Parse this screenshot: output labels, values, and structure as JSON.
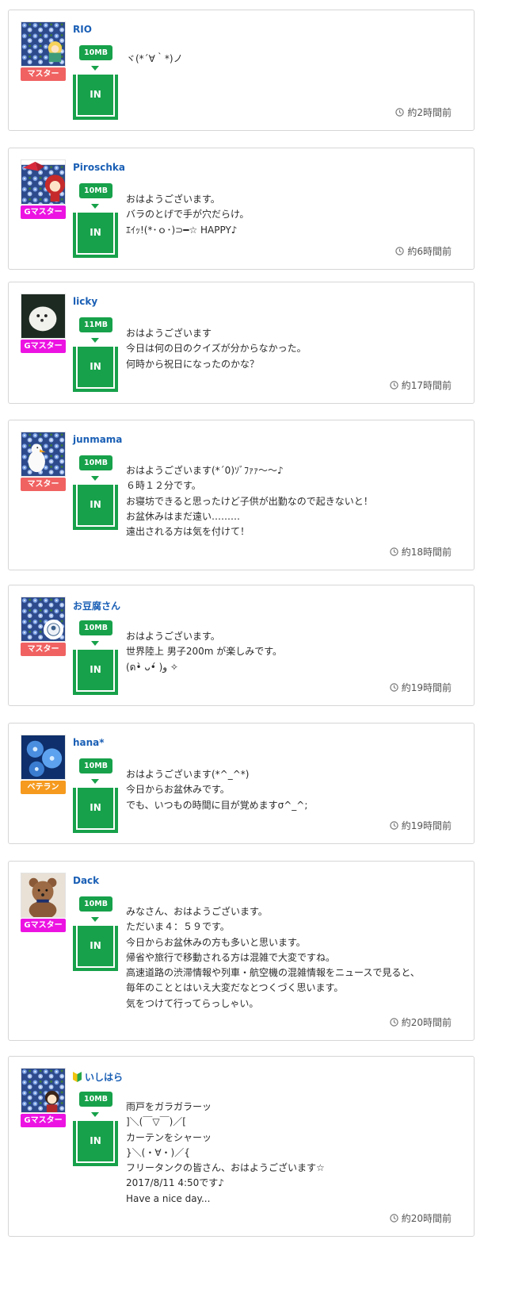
{
  "posts": [
    {
      "username": "RIO",
      "role": "マスター",
      "role_type": "master",
      "avatar_icon": "flower-avatar-with-character-icon",
      "size": "10MB",
      "in_label": "IN",
      "lines": [
        "ヾ(*´∀｀*)ノ"
      ],
      "time": "約2時間前"
    },
    {
      "username": "Piroschka",
      "role": "Gマスター",
      "role_type": "gmaster",
      "avatar_icon": "ribbon-flower-avatar-icon",
      "size": "10MB",
      "in_label": "IN",
      "lines": [
        "おはようございます。",
        "バラのとげで手が穴だらけ。",
        "ｴｲｯ!(*･ｏ･)⊃━☆ HAPPY♪"
      ],
      "time": "約6時間前"
    },
    {
      "username": "licky",
      "role": "Gマスター",
      "role_type": "gmaster",
      "avatar_icon": "white-dog-avatar-icon",
      "size": "11MB",
      "in_label": "IN",
      "lines": [
        "おはようございます",
        "今日は何の日のクイズが分からなかった。",
        "何時から祝日になったのかな？"
      ],
      "time": "約17時間前"
    },
    {
      "username": "junmama",
      "role": "マスター",
      "role_type": "master",
      "avatar_icon": "swan-flower-avatar-icon",
      "size": "10MB",
      "in_label": "IN",
      "lines": [
        "おはようございます(*´0)ｿﾞﾌｧｧ～～♪",
        "６時１２分です。",
        "お寝坊できると思ったけど子供が出勤なので起きないと！",
        "お盆休みはまだ遠い………",
        "遠出される方は気を付けて！"
      ],
      "time": "約18時間前"
    },
    {
      "username": "お豆腐さん",
      "role": "マスター",
      "role_type": "master",
      "avatar_icon": "flower-avatar-with-emblem-icon",
      "size": "10MB",
      "in_label": "IN",
      "lines": [
        "おはようございます。",
        "世界陸上 男子200m が楽しみです。",
        "(ด•̀ ᴗ•́ )و ✧"
      ],
      "time": "約19時間前"
    },
    {
      "username": "hana*",
      "role": "ベテラン",
      "role_type": "veteran",
      "avatar_icon": "blue-flower-avatar-icon",
      "size": "10MB",
      "in_label": "IN",
      "lines": [
        "おはようございます(*^_^*)",
        "今日からお盆休みです。",
        "でも、いつもの時間に目が覚めますσ^_^;"
      ],
      "time": "約19時間前"
    },
    {
      "username": "Dack",
      "role": "Gマスター",
      "role_type": "gmaster",
      "avatar_icon": "teddy-bear-avatar-icon",
      "size": "10MB",
      "in_label": "IN",
      "lines": [
        "みなさん、おはようございます。",
        "ただいま４：５９です。",
        "今日からお盆休みの方も多いと思います。",
        "帰省や旅行で移動される方は混雑で大変ですね。",
        "高速道路の渋滞情報や列車・航空機の混雑情報をニュースで見ると、",
        "毎年のこととはいえ大変だなとつくづく思います。",
        "気をつけて行ってらっしゃい。"
      ],
      "time": "約20時間前"
    },
    {
      "username": "いしはら",
      "role": "Gマスター",
      "role_type": "gmaster",
      "avatar_icon": "flower-avatar-with-boy-icon",
      "beginner_icon": "beginner-leaf-icon",
      "size": "10MB",
      "in_label": "IN",
      "lines": [
        "雨戸をガラガラーッ",
        "]＼(￣▽￣)／[",
        "カーテンをシャーッ",
        "}＼(・∀・)／{",
        "フリータンクの皆さん、おはようございます☆",
        "2017/8/11 4:50です♪",
        "Have a nice day..."
      ],
      "time": "約20時間前"
    }
  ],
  "colors": {
    "username": "#1a5fb5",
    "green": "#17a14a",
    "master": "#f06262",
    "gmaster": "#ec13e2",
    "veteran": "#f59a1e"
  }
}
